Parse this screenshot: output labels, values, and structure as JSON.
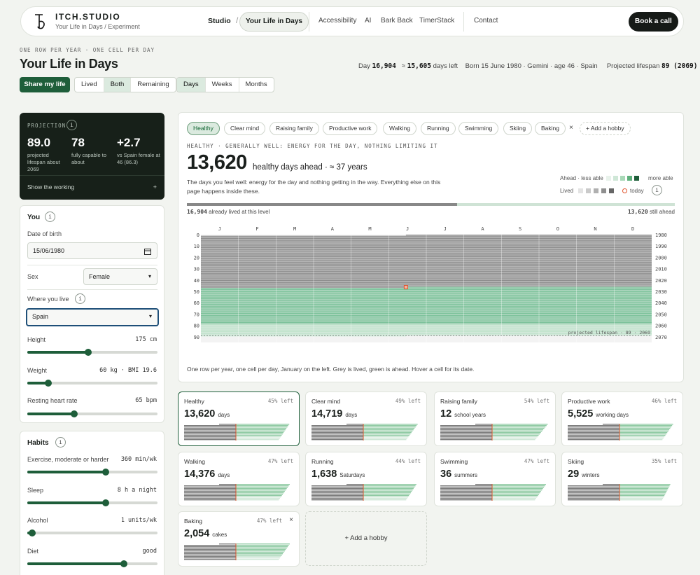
{
  "nav": {
    "brand": "ITCH.STUDIO",
    "subtitle": "Your Life in Days / Experiment",
    "crumb_studio": "Studio",
    "crumb_sep": "/",
    "crumb_current": "Your Life in Days",
    "links": [
      "Accessibility",
      "AI",
      "Bark Back",
      "TimerStack"
    ],
    "contact": "Contact",
    "cta": "Book a call"
  },
  "header": {
    "kicker": "ONE ROW PER YEAR · ONE CELL PER DAY",
    "title": "Your Life in Days",
    "day_prefix": "Day",
    "day_value": "16,904",
    "days_left_prefix": "≈",
    "days_left_value": "15,605",
    "days_left_suffix": "days left",
    "born": "Born 15 June 1980 · Gemini · age 46 · Spain",
    "lifespan_prefix": "Projected lifespan",
    "lifespan_value": "89 (2069)"
  },
  "controls": {
    "share": "Share my life",
    "view": [
      "Lived",
      "Both",
      "Remaining"
    ],
    "view_selected": "Both",
    "unit": [
      "Days",
      "Weeks",
      "Months"
    ],
    "unit_selected": "Days"
  },
  "projection": {
    "title": "PROJECTION",
    "info": "i",
    "stats": [
      {
        "value": "89.0",
        "label": "projected lifespan about 2069"
      },
      {
        "value": "78",
        "label": "fully capable to about"
      },
      {
        "value": "+2.7",
        "label": "vs Spain female at 46 (86.3)"
      }
    ],
    "show": "Show the working",
    "toggle": "+"
  },
  "you": {
    "title": "You",
    "info": "i",
    "dob_label": "Date of birth",
    "dob_value": "15/06/1980",
    "sex_label": "Sex",
    "sex_value": "Female",
    "where_label": "Where you live",
    "where_value": "Spain",
    "height_label": "Height",
    "height_value": "175 cm",
    "height_level": 0.47,
    "weight_label": "Weight",
    "weight_value": "60 kg · BMI 19.6",
    "weight_level": 0.16,
    "rhr_label": "Resting heart rate",
    "rhr_value": "65 bpm",
    "rhr_level": 0.36
  },
  "habits": {
    "title": "Habits",
    "info": "i",
    "exercise_label": "Exercise, moderate or harder",
    "exercise_value": "360 min/wk",
    "exercise_level": 0.6,
    "sleep_label": "Sleep",
    "sleep_value": "8 h a night",
    "sleep_level": 0.6,
    "alcohol_label": "Alcohol",
    "alcohol_value": "1 units/wk",
    "alcohol_level": 0.04,
    "diet_label": "Diet",
    "diet_value": "good",
    "diet_level": 0.74
  },
  "chips": [
    "Healthy",
    "Clear mind",
    "Raising family",
    "Productive work",
    "Walking",
    "Running",
    "Swimming",
    "Skiing",
    "Baking"
  ],
  "chip_selected": "Healthy",
  "chip_close": "×",
  "chip_add": "+ Add a hobby",
  "detail": {
    "kicker": "HEALTHY · GENERALLY WELL: ENERGY FOR THE DAY, NOTHING LIMITING IT",
    "value": "13,620",
    "unit": "healthy days ahead · ≈ 37 years",
    "desc": "The days you feel well: energy for the day and nothing getting in the way. Everything else on this page happens inside these.",
    "legend_ahead": "Ahead · less able",
    "legend_more": "more able",
    "legend_lived": "Lived",
    "legend_today": "today",
    "legend_info": "i",
    "lived_value": "16,904",
    "lived_suffix": "already lived at this level",
    "ahead_value": "13,620",
    "ahead_suffix": "still ahead",
    "lived_fraction": 0.554,
    "caption": "One row per year, one cell per day, January on the left. Grey is lived, green is ahead. Hover a cell for its date."
  },
  "grid": {
    "months": [
      "J",
      "F",
      "M",
      "A",
      "M",
      "J",
      "J",
      "A",
      "S",
      "O",
      "N",
      "D"
    ],
    "ages": [
      "0",
      "10",
      "20",
      "30",
      "40",
      "50",
      "60",
      "70",
      "80",
      "90"
    ],
    "years": [
      "1980",
      "1990",
      "2000",
      "2010",
      "2020",
      "2030",
      "2040",
      "2050",
      "2060",
      "2070"
    ],
    "lifespan_note": "projected lifespan · 89 · 2069",
    "age_now": 46,
    "lifespan": 89,
    "capable_to": 78,
    "birth_day_of_year": 166,
    "today_day_of_year": 166
  },
  "colors": {
    "accent": "#1e5e3a",
    "lived": "#8f8f8f",
    "ahead": "#a9d9b8",
    "ahead_less": "#d9efe1",
    "today": "#e0552e",
    "dark_card": "#172019"
  },
  "tiles": [
    {
      "name": "Healthy",
      "pct": "45% left",
      "value": "13,620",
      "unit": "days"
    },
    {
      "name": "Clear mind",
      "pct": "49% left",
      "value": "14,719",
      "unit": "days"
    },
    {
      "name": "Raising family",
      "pct": "54% left",
      "value": "12",
      "unit": "school years"
    },
    {
      "name": "Productive work",
      "pct": "46% left",
      "value": "5,525",
      "unit": "working days"
    },
    {
      "name": "Walking",
      "pct": "47% left",
      "value": "14,376",
      "unit": "days"
    },
    {
      "name": "Running",
      "pct": "44% left",
      "value": "1,638",
      "unit": "Saturdays"
    },
    {
      "name": "Swimming",
      "pct": "47% left",
      "value": "36",
      "unit": "summers"
    },
    {
      "name": "Skiing",
      "pct": "35% left",
      "value": "29",
      "unit": "winters"
    },
    {
      "name": "Baking",
      "pct": "47% left",
      "value": "2,054",
      "unit": "cakes",
      "close": "×"
    }
  ],
  "add_hobby": "+ Add a hobby"
}
